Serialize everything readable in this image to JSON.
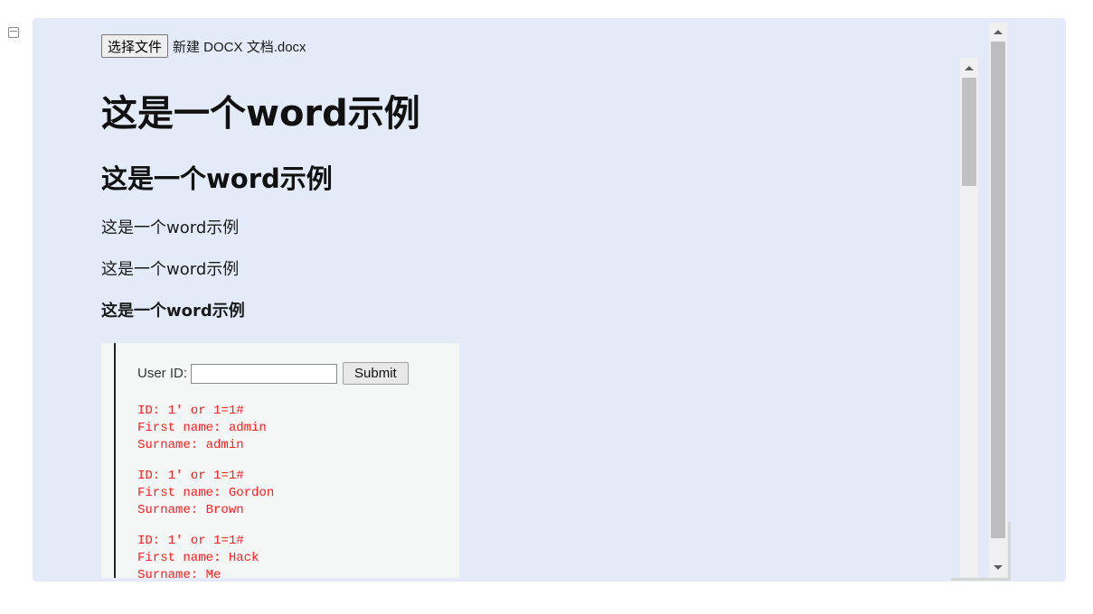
{
  "file_picker": {
    "button_label": "选择文件",
    "file_name": "新建 DOCX 文档.docx"
  },
  "document": {
    "heading1": "这是一个word示例",
    "heading2": "这是一个word示例",
    "paragraph1": "这是一个word示例",
    "paragraph2": "这是一个word示例",
    "paragraph_bold": "这是一个word示例"
  },
  "embedded_screenshot": {
    "user_id_label": "User ID:",
    "user_id_value": "",
    "submit_label": "Submit",
    "results": [
      {
        "id": "ID: 1' or 1=1#",
        "first_name": "First name: admin",
        "surname": "Surname: admin"
      },
      {
        "id": "ID: 1' or 1=1#",
        "first_name": "First name: Gordon",
        "surname": "Surname: Brown"
      },
      {
        "id": "ID: 1' or 1=1#",
        "first_name": "First name: Hack",
        "surname": "Surname: Me"
      }
    ]
  },
  "icons": {
    "left_gutter": "window-icon",
    "scroll_up": "scroll-up-arrow-icon",
    "scroll_down": "scroll-down-arrow-icon"
  },
  "colors": {
    "panel_background": "#e3ebf8",
    "result_text": "#ff2020"
  }
}
